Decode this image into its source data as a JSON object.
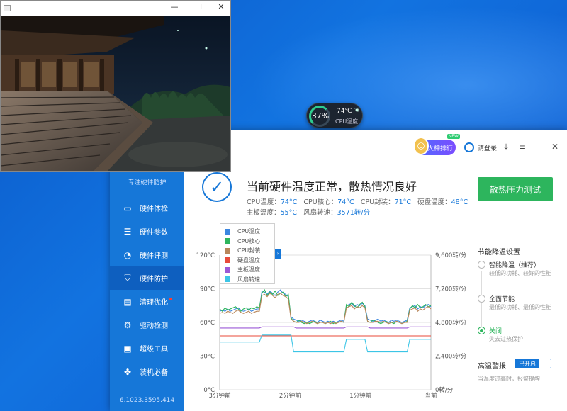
{
  "desktop_widget": {
    "percent": "37%",
    "temp": "74℃",
    "label": "CPU温度"
  },
  "app": {
    "slogan": "专注硬件防护",
    "version": "6.1023.3595.414",
    "nav": [
      {
        "label": "硬件体检",
        "icon": "monitor-icon"
      },
      {
        "label": "硬件参数",
        "icon": "list-icon"
      },
      {
        "label": "硬件评测",
        "icon": "gauge-icon"
      },
      {
        "label": "硬件防护",
        "icon": "shield-icon",
        "active": true
      },
      {
        "label": "清理优化",
        "icon": "broom-icon",
        "badge": true
      },
      {
        "label": "驱动检测",
        "icon": "gear-icon"
      },
      {
        "label": "超级工具",
        "icon": "toolbox-icon"
      },
      {
        "label": "装机必备",
        "icon": "apps-icon"
      }
    ],
    "topbar": {
      "rank_label": "大神排行",
      "rank_badge": "NEW",
      "login_label": "请登录"
    },
    "status": {
      "title": "当前硬件温度正常，散热情况良好",
      "items_row1": [
        {
          "label": "CPU温度：",
          "value": "74°C"
        },
        {
          "label": "CPU核心：",
          "value": "74°C"
        },
        {
          "label": "CPU封装：",
          "value": "71°C"
        },
        {
          "label": "硬盘温度：",
          "value": "48°C"
        }
      ],
      "items_row2": [
        {
          "label": "主板温度：",
          "value": "55°C"
        },
        {
          "label": "风扇转速：",
          "value": "3571转/分"
        }
      ]
    },
    "stress_button": "散热压力测试",
    "settings": {
      "title": "节能降温设置",
      "options": [
        {
          "title": "智能降温（推荐）",
          "desc": "较低的功耗、较好的性能",
          "selected": false
        },
        {
          "title": "全面节能",
          "desc": "最低的功耗、最低的性能",
          "selected": false
        },
        {
          "title": "关闭",
          "desc": "失去过热保护",
          "selected": true
        }
      ]
    },
    "alarm": {
      "title": "高温警报",
      "toggle_label": "已开启",
      "desc": "当温度过高时，报警提醒"
    }
  },
  "chart_data": {
    "type": "line",
    "x_labels": [
      "3分钟前",
      "2分钟前",
      "1分钟前",
      "当前"
    ],
    "y_left_ticks": [
      "0°C",
      "30°C",
      "60°C",
      "90°C",
      "120°C"
    ],
    "y_right_ticks": [
      "0转/分",
      "2,400转/分",
      "4,800转/分",
      "7,200转/分",
      "9,600转/分"
    ],
    "y_left_range": [
      0,
      120
    ],
    "y_right_range": [
      0,
      9600
    ],
    "grid": true,
    "series": [
      {
        "name": "CPU温度",
        "color": "#3b86e0",
        "axis": "left",
        "values": [
          70,
          71,
          70,
          72,
          70,
          71,
          72,
          73,
          71,
          70,
          71,
          72,
          70,
          71,
          72,
          72,
          88,
          87,
          85,
          88,
          86,
          84,
          87,
          89,
          86,
          85,
          83,
          65,
          63,
          62,
          61,
          62,
          61,
          60,
          61,
          62,
          61,
          60,
          62,
          61,
          60,
          61,
          60,
          61,
          60,
          61,
          62,
          61,
          75,
          76,
          77,
          74,
          76,
          75,
          77,
          75,
          63,
          62,
          61,
          62,
          63,
          61,
          62,
          61,
          60,
          62,
          61,
          62,
          61,
          60,
          61,
          62,
          73,
          74,
          75,
          72,
          74,
          73,
          75,
          76,
          74
        ]
      },
      {
        "name": "CPU核心",
        "color": "#2db55d",
        "axis": "left",
        "values": [
          72,
          70,
          73,
          71,
          72,
          73,
          74,
          72,
          70,
          72,
          73,
          71,
          73,
          72,
          74,
          73,
          86,
          89,
          84,
          87,
          85,
          88,
          84,
          86,
          87,
          83,
          85,
          64,
          61,
          60,
          62,
          60,
          59,
          60,
          59,
          60,
          61,
          59,
          60,
          60,
          59,
          60,
          61,
          59,
          60,
          60,
          61,
          60,
          76,
          74,
          78,
          75,
          73,
          76,
          78,
          74,
          61,
          60,
          62,
          61,
          60,
          59,
          60,
          61,
          59,
          60,
          59,
          61,
          60,
          59,
          60,
          61,
          72,
          75,
          73,
          76,
          73,
          74,
          76,
          74,
          75
        ]
      },
      {
        "name": "CPU封装",
        "color": "#b8865a",
        "axis": "left",
        "values": [
          68,
          69,
          68,
          70,
          69,
          68,
          70,
          71,
          69,
          68,
          69,
          70,
          68,
          69,
          70,
          70,
          84,
          85,
          83,
          86,
          84,
          82,
          85,
          86,
          84,
          83,
          81,
          63,
          61,
          60,
          60,
          61,
          60,
          59,
          60,
          61,
          60,
          59,
          60,
          60,
          59,
          60,
          59,
          60,
          59,
          60,
          61,
          60,
          73,
          74,
          75,
          72,
          74,
          73,
          75,
          73,
          61,
          60,
          60,
          61,
          61,
          60,
          61,
          60,
          59,
          60,
          60,
          61,
          60,
          59,
          60,
          60,
          71,
          72,
          73,
          70,
          72,
          71,
          73,
          74,
          72
        ]
      },
      {
        "name": "硬盘温度",
        "color": "#e84a3a",
        "axis": "left",
        "values": [
          48,
          48,
          48,
          48,
          48,
          48,
          48,
          48,
          48,
          48,
          48,
          48,
          48,
          48,
          48,
          48,
          48,
          48,
          48,
          48,
          48,
          48,
          48,
          48,
          48,
          48,
          48,
          48,
          48,
          48,
          48,
          48,
          48,
          48,
          48,
          48,
          48,
          48,
          48,
          48,
          48,
          48,
          48,
          48,
          48,
          48,
          48,
          48,
          48,
          48,
          48,
          48,
          48,
          48,
          48,
          48,
          48,
          48,
          48,
          48,
          48,
          48,
          48,
          48,
          48,
          48,
          48,
          48,
          48,
          48,
          48,
          48,
          48,
          48,
          48,
          48,
          48,
          48,
          48,
          48,
          48
        ]
      },
      {
        "name": "主板温度",
        "color": "#9b59d6",
        "axis": "left",
        "values": [
          55,
          55,
          55,
          55,
          55,
          55,
          55,
          55,
          55,
          55,
          55,
          55,
          55,
          55,
          55,
          55,
          56,
          56,
          56,
          56,
          56,
          56,
          56,
          56,
          56,
          56,
          56,
          56,
          56,
          55,
          55,
          55,
          55,
          55,
          55,
          55,
          55,
          55,
          55,
          55,
          55,
          55,
          55,
          55,
          55,
          55,
          55,
          55,
          56,
          56,
          56,
          56,
          56,
          56,
          56,
          56,
          56,
          55,
          55,
          55,
          55,
          55,
          55,
          55,
          55,
          55,
          55,
          55,
          55,
          55,
          55,
          55,
          56,
          56,
          56,
          56,
          56,
          56,
          56,
          56,
          56
        ]
      },
      {
        "name": "风扇转速",
        "color": "#3cc5e6",
        "axis": "right",
        "values": [
          3400,
          3400,
          3400,
          3400,
          3400,
          3400,
          3400,
          3400,
          3400,
          3400,
          3400,
          3400,
          3400,
          3400,
          3400,
          3400,
          3900,
          3900,
          3900,
          3900,
          3900,
          3900,
          3900,
          3900,
          3900,
          3900,
          3900,
          3900,
          2700,
          2700,
          2700,
          2700,
          2700,
          2700,
          2700,
          2700,
          2700,
          2700,
          2700,
          2700,
          2700,
          2700,
          2700,
          2700,
          2700,
          2700,
          2700,
          2700,
          3600,
          3600,
          3600,
          3600,
          3600,
          3600,
          3600,
          3600,
          2700,
          2700,
          2700,
          2700,
          2700,
          2700,
          2700,
          2700,
          2700,
          2700,
          2700,
          2700,
          2700,
          2700,
          2700,
          2700,
          3600,
          3600,
          3600,
          3600,
          3600,
          3600,
          3600,
          3600,
          3600
        ]
      }
    ]
  }
}
